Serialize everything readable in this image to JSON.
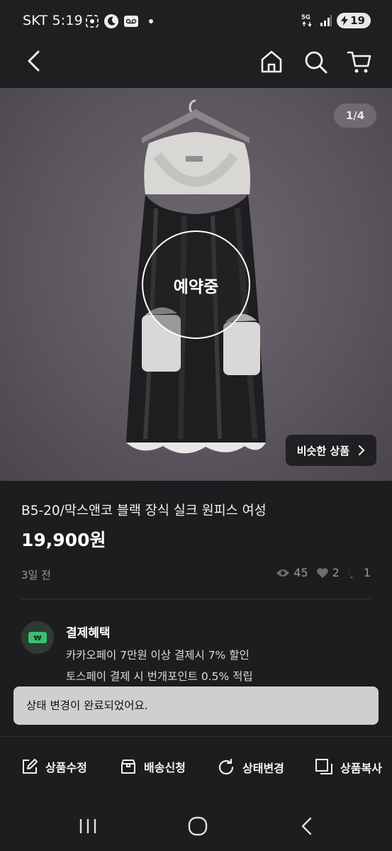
{
  "status_bar": {
    "time": "SKT 5:19",
    "battery": "19",
    "network": "5G"
  },
  "app_bar": {
    "icons": [
      "back-icon",
      "home-icon",
      "search-icon",
      "cart-icon"
    ]
  },
  "gallery": {
    "page_counter": "1/4",
    "reserved_label": "예약중",
    "similar_button": "비슷한 상품"
  },
  "product": {
    "title": "B5-20/막스앤코 블랙 장식 실크 원피스 여성",
    "price": "19,900원",
    "posted": "3일 전",
    "views": "45",
    "likes": "2",
    "chats": "1"
  },
  "benefits": {
    "title": "결제혜택",
    "line1": "카카오페이 7만원 이상 결제시 7% 할인",
    "line2": "토스페이 결제 시 번개포인트 0.5% 적립",
    "icon_text": "₩"
  },
  "toast": {
    "message": "상태 변경이 완료되었어요."
  },
  "actions": {
    "edit": "상품수정",
    "shipping": "배송신청",
    "status": "상태변경",
    "copy": "상품복사"
  },
  "colors": {
    "background": "#1d1d1f",
    "toast": "#cfcfd1",
    "benefit_icon": "#2f3a33",
    "accent": "#ffffff"
  }
}
